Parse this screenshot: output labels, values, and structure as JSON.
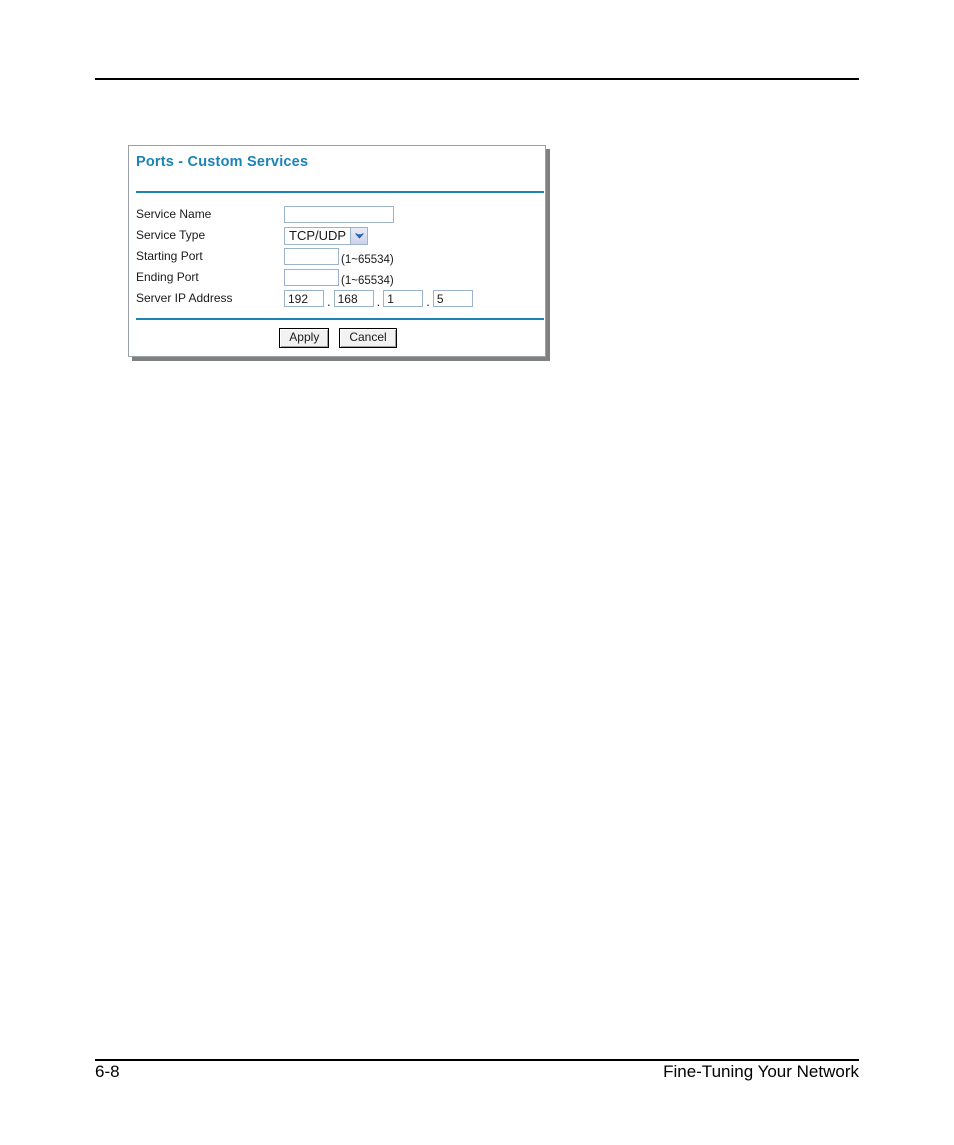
{
  "page": {
    "footer": {
      "page_number": "6-8",
      "section_title": "Fine-Tuning Your Network"
    }
  },
  "dialog": {
    "title": "Ports - Custom Services",
    "fields": {
      "service_name": {
        "label": "Service Name",
        "value": "",
        "placeholder": ""
      },
      "service_type": {
        "label": "Service Type",
        "selected": "TCP/UDP",
        "arrow_icon": "chevron-down-icon"
      },
      "starting_port": {
        "label": "Starting Port",
        "value": "",
        "hint": "(1~65534)"
      },
      "ending_port": {
        "label": "Ending Port",
        "value": "",
        "hint": "(1~65534)"
      },
      "server_ip_address": {
        "label": "Server IP Address",
        "octets": [
          "192",
          "168",
          "1",
          "5"
        ],
        "separator": "."
      }
    },
    "buttons": {
      "apply": "Apply",
      "cancel": "Cancel"
    },
    "colors": {
      "title": "#1b83b5",
      "rule": "#1b83b5",
      "input_border": "#9bb4cc"
    }
  }
}
